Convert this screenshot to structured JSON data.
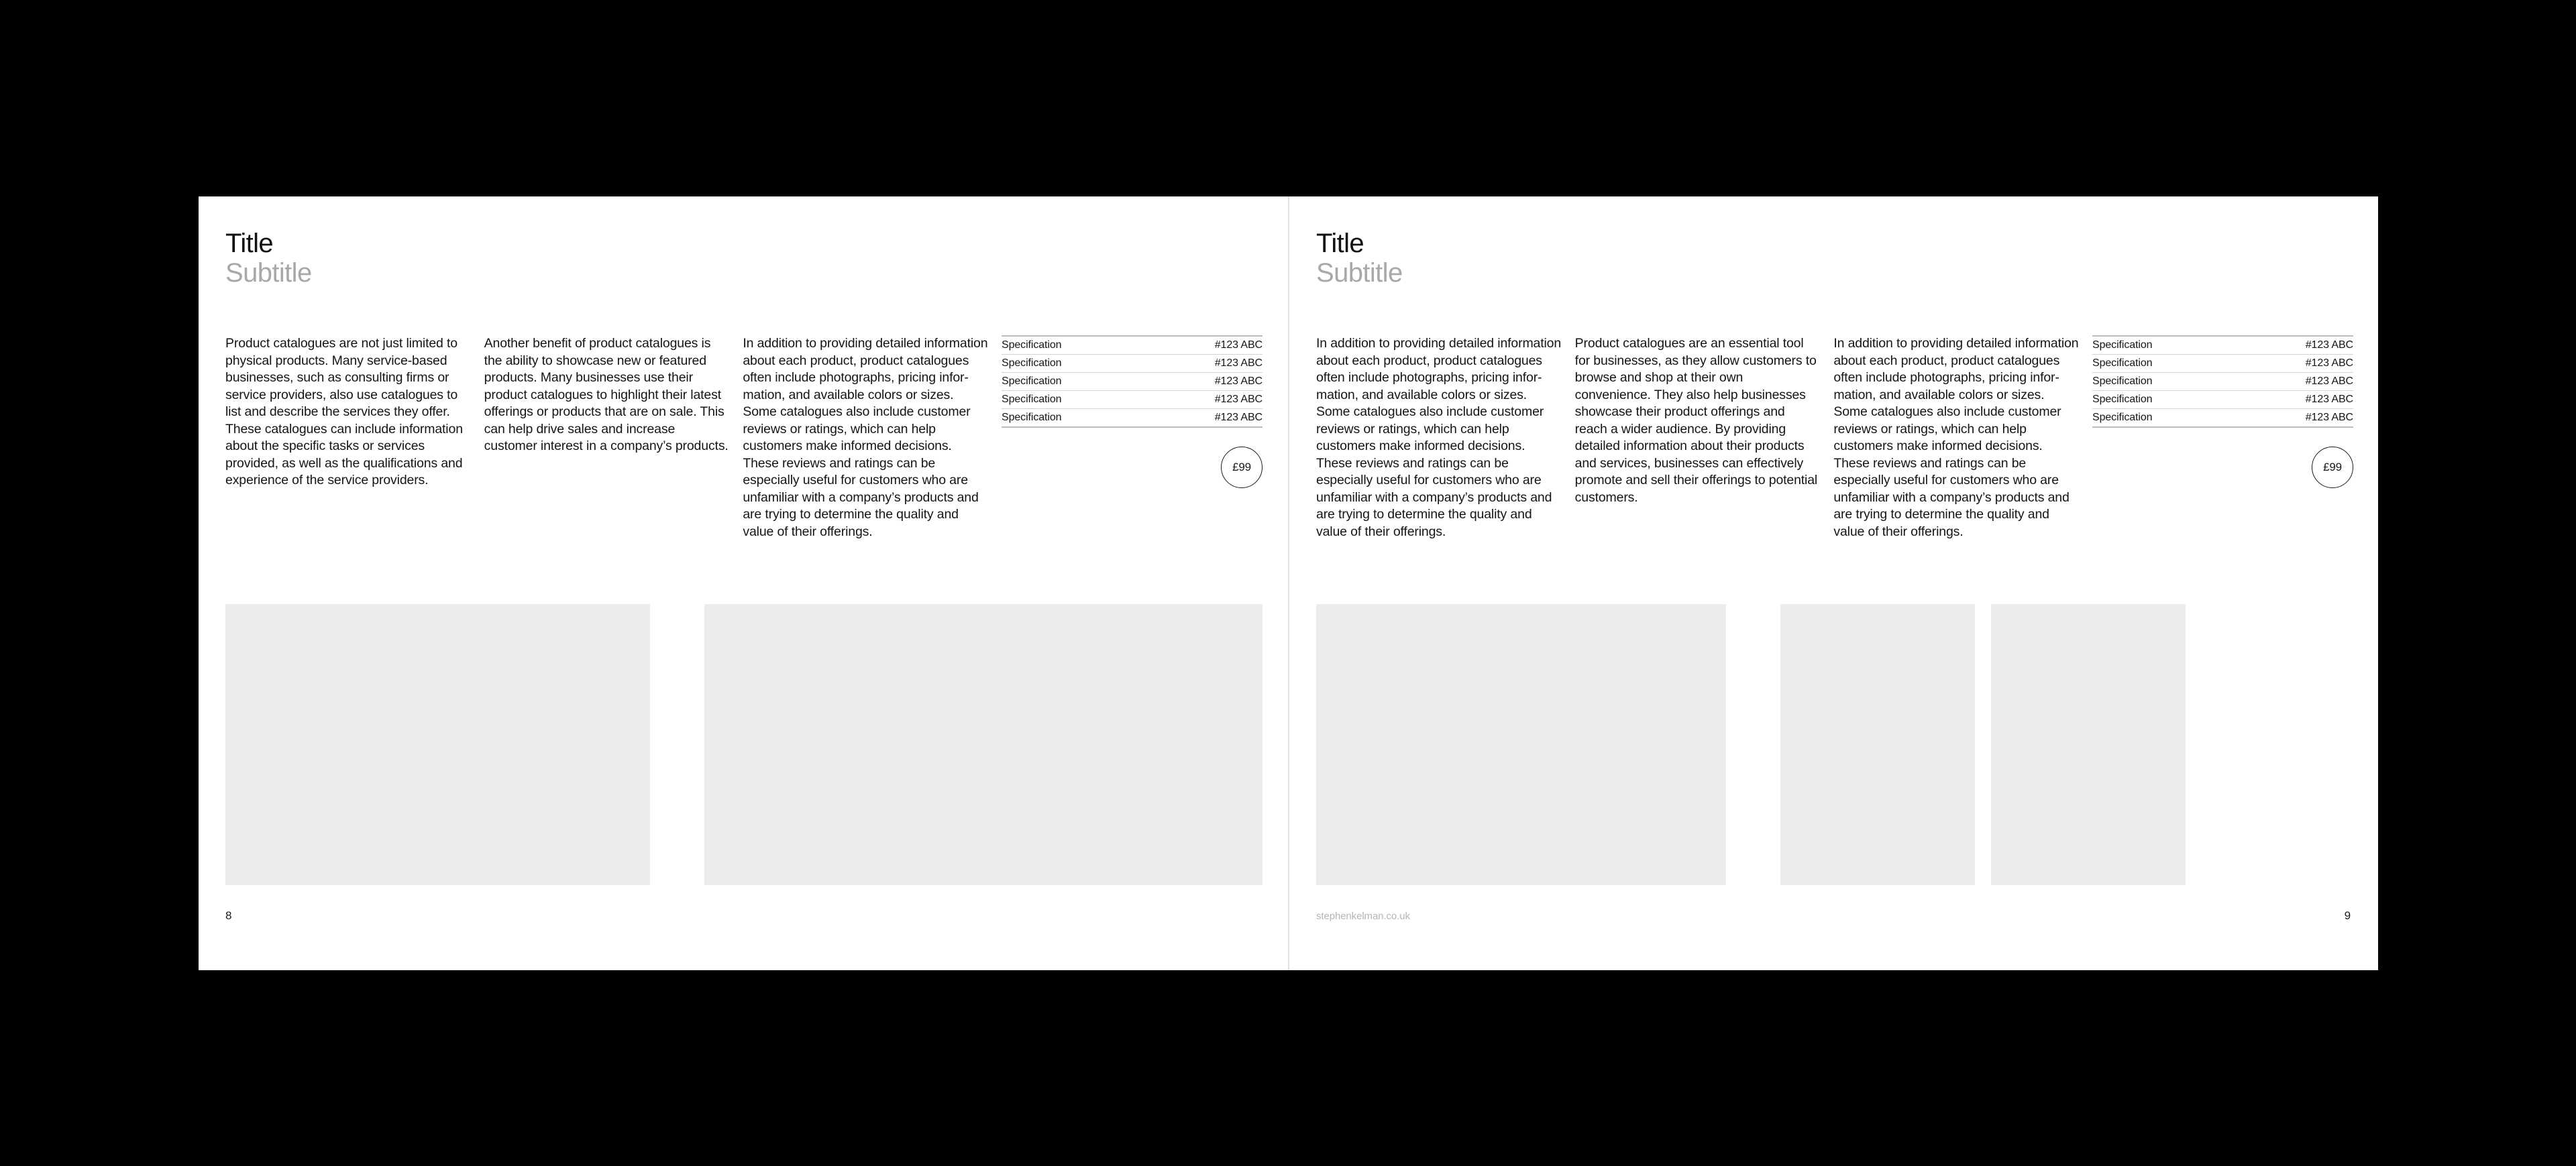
{
  "document": {
    "background_color": "#000000",
    "page_color": "#ffffff",
    "placeholder_color": "#ececec",
    "subtitle_color": "#a8a8a8",
    "url_color": "#b5b5b5"
  },
  "left_page": {
    "title": "Title",
    "subtitle": "Subtitle",
    "columns": [
      {
        "text": "Product catalogues are not just limited to physical products. Many service-based businesses, such as consulting firms or service providers, also use catalogues to list and describe the services they offer. These catalogues can include information about the specific tasks or services provided, as well as the qualifications and experience of the service providers."
      },
      {
        "text": "Another benefit of product catalogues is the ability to showcase new or featured products. Many businesses use their product catalogues to highlight their latest offerings or products that are on sale. This can help drive sales and increase customer interest in a company’s products."
      },
      {
        "text": "In addition to providing detailed information about each product, product catalogues often include photographs, pricing infor-mation, and available colors or sizes. Some catalogues also include customer reviews or ratings, which can help customers make informed decisions. These reviews and ratings can be especially useful for customers who are unfamiliar with a company’s products and are trying to determine the quality and value of their offerings."
      }
    ],
    "spec_table": {
      "rows": [
        {
          "name": "Specification",
          "value": "#123 ABC"
        },
        {
          "name": "Specification",
          "value": "#123 ABC"
        },
        {
          "name": "Specification",
          "value": "#123 ABC"
        },
        {
          "name": "Specification",
          "value": "#123 ABC"
        },
        {
          "name": "Specification",
          "value": "#123 ABC"
        }
      ]
    },
    "price_badge": "£99",
    "image_placeholders": [
      {
        "name": "image-placeholder-1"
      },
      {
        "name": "image-placeholder-2"
      }
    ],
    "footer": {
      "folio": "8",
      "site_url": ""
    }
  },
  "right_page": {
    "title": "Title",
    "subtitle": "Subtitle",
    "columns": [
      {
        "text": "In addition to providing detailed information about each product, product catalogues often include photographs, pricing infor-mation, and available colors or sizes. Some catalogues also include customer reviews or ratings, which can help customers make informed decisions. These reviews and ratings can be especially useful for customers who are unfamiliar with a company’s products and are trying to determine the quality and value of their offerings."
      },
      {
        "text": "Product catalogues are an essential tool for businesses, as they allow customers to browse and shop at their own convenience. They also help businesses showcase their product offerings and reach a wider audience. By providing detailed information about their products and services, businesses can effectively promote and sell their offerings to potential customers."
      },
      {
        "text": "In addition to providing detailed information about each product, product catalogues often include photographs, pricing infor-mation, and available colors or sizes. Some catalogues also include customer reviews or ratings, which can help customers make informed decisions. These reviews and ratings can be especially useful for customers who are unfamiliar with a company’s products and are trying to determine the quality and value of their offerings."
      }
    ],
    "spec_table": {
      "rows": [
        {
          "name": "Specification",
          "value": "#123 ABC"
        },
        {
          "name": "Specification",
          "value": "#123 ABC"
        },
        {
          "name": "Specification",
          "value": "#123 ABC"
        },
        {
          "name": "Specification",
          "value": "#123 ABC"
        },
        {
          "name": "Specification",
          "value": "#123 ABC"
        }
      ]
    },
    "price_badge": "£99",
    "image_placeholders": [
      {
        "name": "image-placeholder-1"
      },
      {
        "name": "image-placeholder-2"
      },
      {
        "name": "image-placeholder-3"
      }
    ],
    "footer": {
      "site_url": "stephenkelman.co.uk",
      "folio": "9"
    }
  }
}
